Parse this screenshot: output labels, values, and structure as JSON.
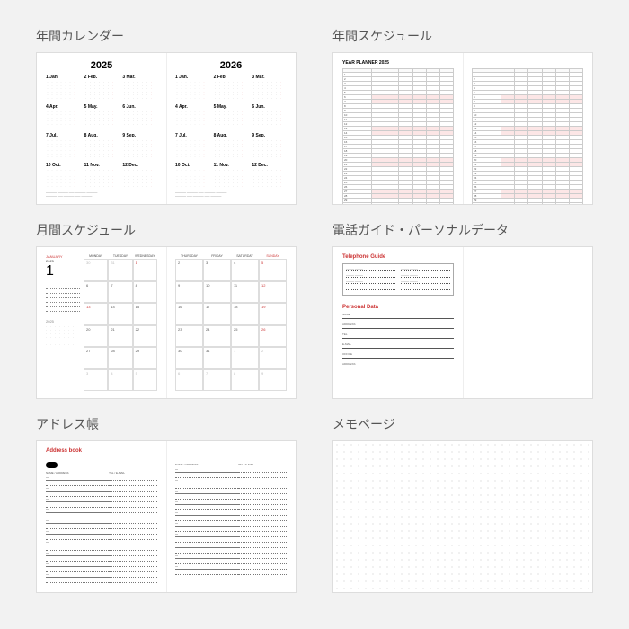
{
  "sections": {
    "yearly_calendar": {
      "label": "年間カレンダー",
      "years": [
        "2025",
        "2026"
      ]
    },
    "yearly_schedule": {
      "label": "年間スケジュール",
      "title": "YEAR PLANNER 2025"
    },
    "monthly_schedule": {
      "label": "月間スケジュール",
      "month_en": "JANUARY",
      "year": "2025",
      "month_num": "1",
      "mini_label": "2025",
      "days_left": [
        "MONDAY",
        "TUESDAY",
        "WEDNESDAY"
      ],
      "days_right": [
        "THURSDAY",
        "FRIDAY",
        "SATURDAY",
        "SUNDAY"
      ]
    },
    "telephone_personal": {
      "label": "電話ガイド・パーソナルデータ",
      "tel_title": "Telephone Guide",
      "pd_title": "Personal Data",
      "pd_fields": [
        "NAME",
        "ADDRESS",
        "TEL",
        "E-MAIL",
        "OFFICE",
        "ADDRESS"
      ]
    },
    "address_book": {
      "label": "アドレス帳",
      "title": "Address book",
      "head_left": "NAME / ADDRESS",
      "head_right": "TEL / E-MAIL"
    },
    "memo": {
      "label": "メモページ"
    }
  },
  "month_short": [
    "Jan.",
    "Feb.",
    "Mar.",
    "Apr.",
    "May.",
    "Jun.",
    "Jul.",
    "Aug.",
    "Sep.",
    "Oct.",
    "Nov.",
    "Dec."
  ]
}
